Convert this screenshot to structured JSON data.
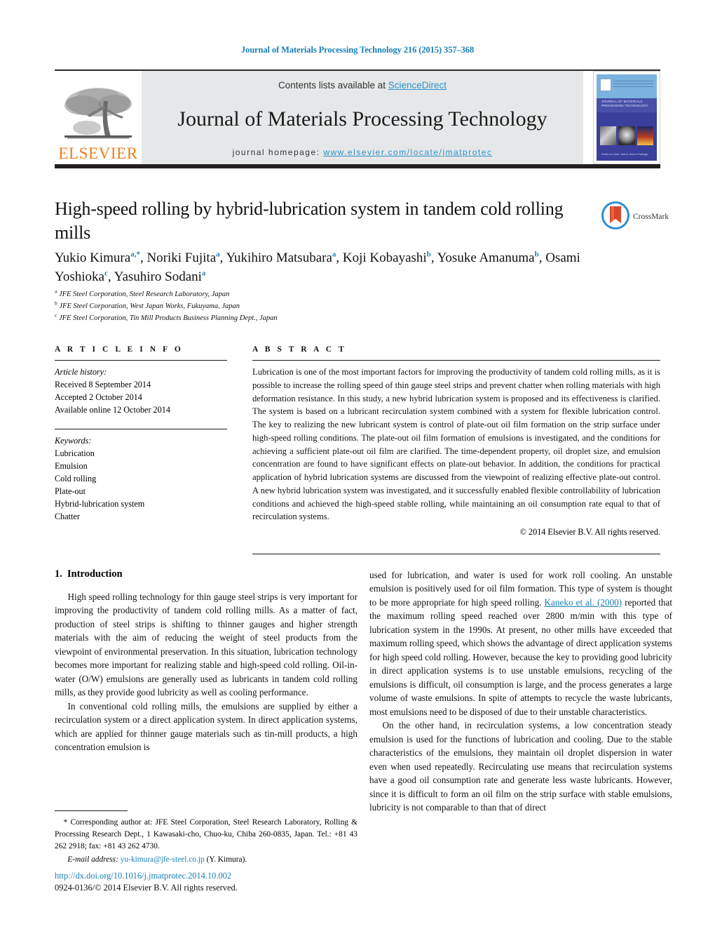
{
  "running_head": "Journal of Materials Processing Technology 216 (2015) 357–368",
  "masthead": {
    "contents_prefix": "Contents lists available at ",
    "sciencedirect": "ScienceDirect",
    "journal_name": "Journal of Materials Processing Technology",
    "homepage_prefix": "journal homepage: ",
    "homepage_url": "www.elsevier.com/locate/jmatprotec",
    "publisher_wordmark": "ELSEVIER",
    "publisher_logo_icon": "elsevier-tree-icon",
    "cover": {
      "title_line1": "JOURNAL OF MATERIALS",
      "title_line2": "PROCESSING TECHNOLOGY",
      "footer": "Editor-in-Chief: and A. Bruce Palange"
    }
  },
  "article": {
    "title": "High-speed rolling by hybrid-lubrication system in tandem cold rolling mills",
    "crossmark_label": "CrossMark",
    "crossmark_icon": "crossmark-icon",
    "authors": [
      {
        "name": "Yukio Kimura",
        "marks": "a,*",
        "sep": ", "
      },
      {
        "name": "Noriki Fujita",
        "marks": "a",
        "sep": ", "
      },
      {
        "name": "Yukihiro Matsubara",
        "marks": "a",
        "sep": ", "
      },
      {
        "name": "Koji Kobayashi",
        "marks": "b",
        "sep": ", "
      },
      {
        "name": "Yosuke Amanuma",
        "marks": "b",
        "sep": ", "
      },
      {
        "name": "Osami Yoshioka",
        "marks": "c",
        "sep": ", "
      },
      {
        "name": "Yasuhiro Sodani",
        "marks": "a",
        "sep": ""
      }
    ],
    "affiliations": [
      {
        "mark": "a",
        "text": "JFE Steel Corporation, Steel Research Laboratory, Japan"
      },
      {
        "mark": "b",
        "text": "JFE Steel Corporation, West Japan Works, Fukuyama, Japan"
      },
      {
        "mark": "c",
        "text": "JFE Steel Corporation, Tin Mill Products Business Planning Dept., Japan"
      }
    ]
  },
  "article_info": {
    "heading": "A R T I C L E   I N F O",
    "history_title": "Article history:",
    "history": [
      "Received 8 September 2014",
      "Accepted 2 October 2014",
      "Available online 12 October 2014"
    ],
    "keywords_title": "Keywords:",
    "keywords": [
      "Lubrication",
      "Emulsion",
      "Cold rolling",
      "Plate-out",
      "Hybrid-lubrication system",
      "Chatter"
    ]
  },
  "abstract": {
    "heading": "A B S T R A C T",
    "body": "Lubrication is one of the most important factors for improving the productivity of tandem cold rolling mills, as it is possible to increase the rolling speed of thin gauge steel strips and prevent chatter when rolling materials with high deformation resistance. In this study, a new hybrid lubrication system is proposed and its effectiveness is clarified. The system is based on a lubricant recirculation system combined with a system for flexible lubrication control. The key to realizing the new lubricant system is control of plate-out oil film formation on the strip surface under high-speed rolling conditions. The plate-out oil film formation of emulsions is investigated, and the conditions for achieving a sufficient plate-out oil film are clarified. The time-dependent property, oil droplet size, and emulsion concentration are found to have significant effects on plate-out behavior. In addition, the conditions for practical application of hybrid lubrication systems are discussed from the viewpoint of realizing effective plate-out control. A new hybrid lubrication system was investigated, and it successfully enabled flexible controllability of lubrication conditions and achieved the high-speed stable rolling, while maintaining an oil consumption rate equal to that of recirculation systems.",
    "copyright": "© 2014 Elsevier B.V. All rights reserved."
  },
  "body": {
    "section_number": "1.",
    "section_title": "Introduction",
    "left_paragraphs": [
      "High speed rolling technology for thin gauge steel strips is very important for improving the productivity of tandem cold rolling mills. As a matter of fact, production of steel strips is shifting to thinner gauges and higher strength materials with the aim of reducing the weight of steel products from the viewpoint of environmental preservation. In this situation, lubrication technology becomes more important for realizing stable and high-speed cold rolling. Oil-in-water (O/W) emulsions are generally used as lubricants in tandem cold rolling mills, as they provide good lubricity as well as cooling performance.",
      "In conventional cold rolling mills, the emulsions are supplied by either a recirculation system or a direct application system. In direct application systems, which are applied for thinner gauge materials such as tin-mill products, a high concentration emulsion is"
    ],
    "right_paragraph_1_pre": "used for lubrication, and water is used for work roll cooling. An unstable emulsion is positively used for oil film formation. This type of system is thought to be more appropriate for high speed rolling. ",
    "right_citation": "Kaneko et al. (2000)",
    "right_paragraph_1_post": " reported that the maximum rolling speed reached over 2800 m/min with this type of lubrication system in the 1990s. At present, no other mills have exceeded that maximum rolling speed, which shows the advantage of direct application systems for high speed cold rolling. However, because the key to providing good lubricity in direct application systems is to use unstable emulsions, recycling of the emulsions is difficult, oil consumption is large, and the process generates a large volume of waste emulsions. In spite of attempts to recycle the waste lubricants, most emulsions need to be disposed of due to their unstable characteristics.",
    "right_paragraph_2": "On the other hand, in recirculation systems, a low concentration steady emulsion is used for the functions of lubrication and cooling. Due to the stable characteristics of the emulsions, they maintain oil droplet dispersion in water even when used repeatedly. Recirculating use means that recirculation systems have a good oil consumption rate and generate less waste lubricants. However, since it is difficult to form an oil film on the strip surface with stable emulsions, lubricity is not comparable to than that of direct"
  },
  "footnote": {
    "text": "* Corresponding author at: JFE Steel Corporation, Steel Research Laboratory, Rolling & Processing Research Dept., 1 Kawasaki-cho, Chuo-ku, Chiba 260-0835, Japan. Tel.: +81 43 262 2918; fax: +81 43 262 4730.",
    "email_label": "E-mail address:",
    "email": "yu-kimura@jfe-steel.co.jp",
    "email_person": "(Y. Kimura)."
  },
  "doi": {
    "url": "http://dx.doi.org/10.1016/j.jmatprotec.2014.10.002",
    "issn_line": "0924-0136/© 2014 Elsevier B.V. All rights reserved."
  },
  "colors": {
    "link_blue": "#1a7fb5",
    "sciencedirect_blue": "#2b93c8",
    "elsevier_orange": "#f07c1a",
    "band_gray": "#e6e7e8",
    "rule_dark": "#231f20"
  }
}
